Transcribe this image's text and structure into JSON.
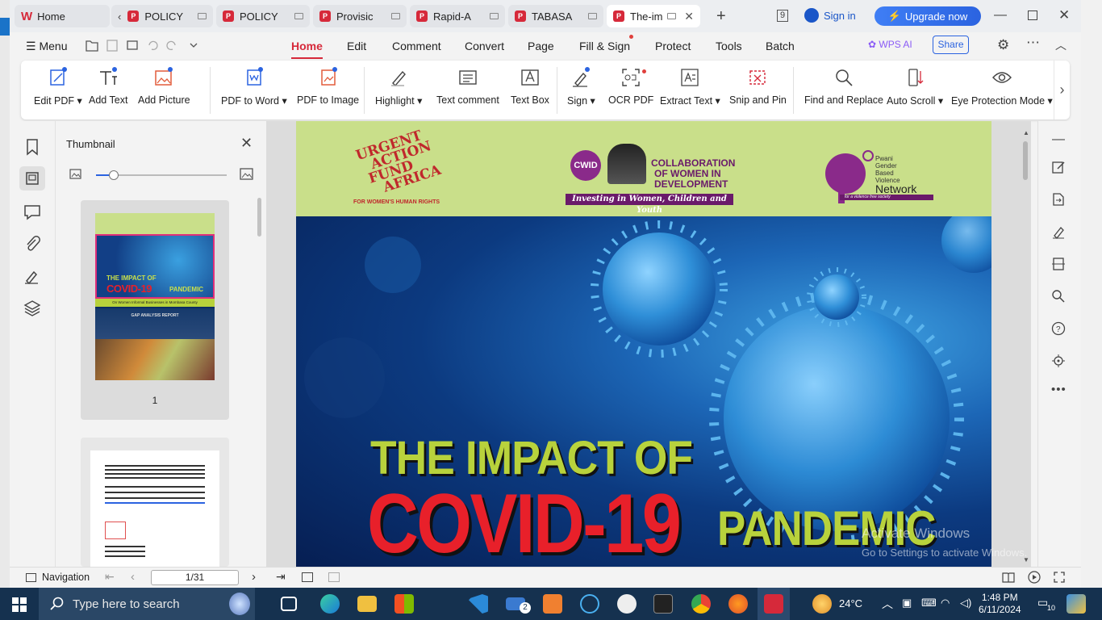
{
  "tabs": [
    {
      "label": "Home",
      "type": "home"
    },
    {
      "label": "POLICY",
      "type": "pdf"
    },
    {
      "label": "POLICY",
      "type": "pdf"
    },
    {
      "label": "Provisic",
      "type": "pdf"
    },
    {
      "label": "Rapid-A",
      "type": "pdf"
    },
    {
      "label": "TABASA",
      "type": "pdf"
    },
    {
      "label": "The-im",
      "type": "pdf",
      "active": true
    }
  ],
  "header": {
    "count_badge": "9",
    "signin": "Sign in",
    "upgrade": "Upgrade now"
  },
  "menu": {
    "menu_label": "Menu",
    "items": [
      "Home",
      "Edit",
      "Comment",
      "Convert",
      "Page",
      "Fill & Sign",
      "Protect",
      "Tools",
      "Batch"
    ],
    "wps_ai": "WPS AI",
    "share": "Share"
  },
  "ribbon": {
    "buttons": [
      {
        "label": "Edit PDF",
        "dropdown": true
      },
      {
        "label": "Add Text"
      },
      {
        "label": "Add Picture"
      },
      {
        "label": "PDF to Word",
        "dropdown": true
      },
      {
        "label": "PDF to Image"
      },
      {
        "label": "Highlight",
        "dropdown": true
      },
      {
        "label": "Text comment"
      },
      {
        "label": "Text Box"
      },
      {
        "label": "Sign",
        "dropdown": true
      },
      {
        "label": "OCR PDF"
      },
      {
        "label": "Extract Text",
        "dropdown": true
      },
      {
        "label": "Snip and Pin"
      },
      {
        "label": "Find and Replace"
      },
      {
        "label": "Auto Scroll",
        "dropdown": true
      },
      {
        "label": "Eye Protection Mode",
        "dropdown": true
      }
    ]
  },
  "thumbnail_panel": {
    "title": "Thumbnail",
    "slider_level": 0.13,
    "page1_label": "1",
    "thumb1_title_a": "THE IMPACT OF",
    "thumb1_title_b": "COVID-19",
    "thumb1_title_c": "PANDEMIC",
    "thumb1_subtitle": "On Women Informal Businesses in Mombasa County",
    "thumb1_report": "GAP ANALYSIS REPORT"
  },
  "document": {
    "logo1_line1": "URGENT",
    "logo1_line2": "ACTION",
    "logo1_line3": "FUND",
    "logo1_line4": "AFRICA",
    "logo1_tag": "FOR WOMEN'S HUMAN RIGHTS",
    "logo2_abbr": "CWID",
    "logo2_line1": "COLLABORATION",
    "logo2_line2": "OF WOMEN IN",
    "logo2_line3": "DEVELOPMENT",
    "logo2_tag": "Investing in Women, Children and Youth",
    "logo3_text1": "Pwani",
    "logo3_text2": "Gender",
    "logo3_text3": "Based",
    "logo3_text4": "Violence",
    "logo3_text5": "Network",
    "logo3_tag": "for a violence free society",
    "title1": "THE IMPACT OF",
    "title2": "COVID-19",
    "title3": "PANDEMIC"
  },
  "watermark": {
    "line1": "Activate Windows",
    "line2": "Go to Settings to activate Windows."
  },
  "status": {
    "navigation": "Navigation",
    "page_input": "1/31"
  },
  "taskbar": {
    "search_placeholder": "Type here to search",
    "weather": "24°C",
    "time": "1:48 PM",
    "date": "6/11/2024",
    "notif_count": "10",
    "mail_badge": "2"
  },
  "colors": {
    "accent": "#d6293a",
    "brand_blue": "#2b63e0",
    "logos_bg": "#c9df8a",
    "title_green": "#b8d23c",
    "title_red": "#e8202a"
  }
}
